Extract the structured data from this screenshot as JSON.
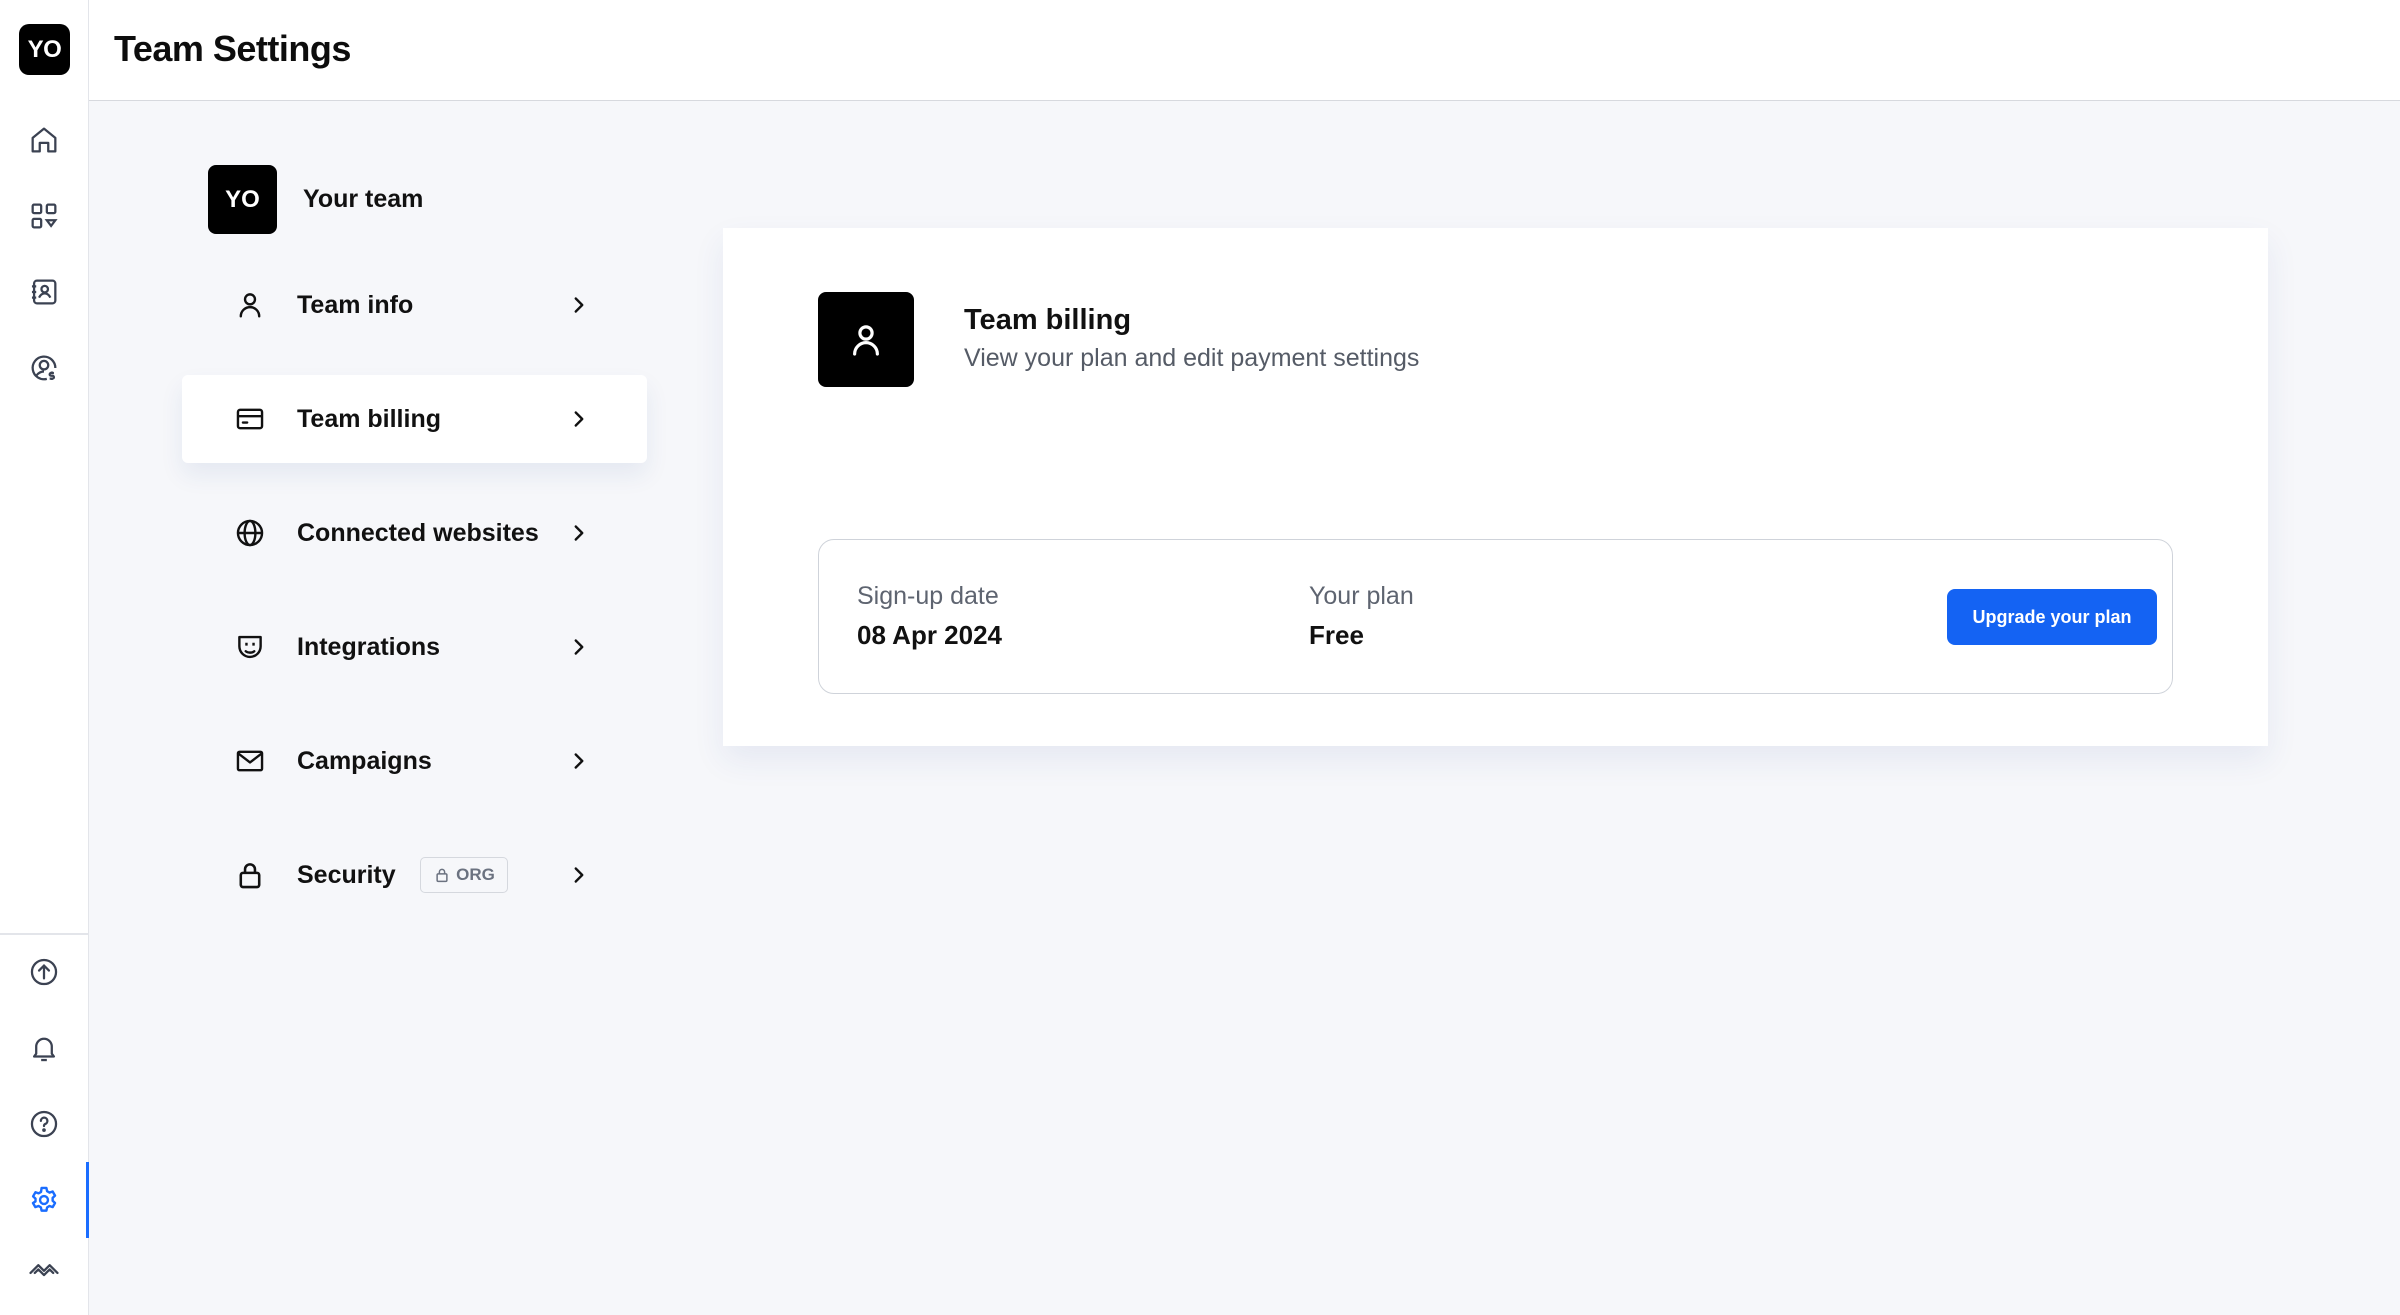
{
  "rail": {
    "logo_text": "YO",
    "top_icons": [
      "home-icon",
      "apps-grid-icon",
      "contacts-book-icon",
      "user-dollar-icon"
    ],
    "bottom_icons": [
      "upload-circle-icon",
      "bell-icon",
      "help-circle-icon",
      "gear-icon",
      "brand-logo-icon"
    ],
    "active_item": "gear-icon",
    "accent_color": "#1a6dff"
  },
  "header": {
    "title": "Team Settings"
  },
  "team": {
    "avatar_text": "YO",
    "name": "Your team"
  },
  "nav": {
    "items": [
      {
        "label": "Team info",
        "icon": "user-icon"
      },
      {
        "label": "Team billing",
        "icon": "credit-card-icon",
        "active": true
      },
      {
        "label": "Connected websites",
        "icon": "globe-icon"
      },
      {
        "label": "Integrations",
        "icon": "plug-icon"
      },
      {
        "label": "Campaigns",
        "icon": "mail-icon"
      },
      {
        "label": "Security",
        "icon": "lock-icon",
        "badge": "ORG"
      }
    ]
  },
  "card": {
    "title": "Team billing",
    "subtitle": "View your plan and edit payment settings",
    "signup_label": "Sign-up date",
    "signup_value": "08 Apr 2024",
    "plan_label": "Your plan",
    "plan_value": "Free",
    "upgrade_label": "Upgrade your plan",
    "button_color": "#1463f3"
  }
}
